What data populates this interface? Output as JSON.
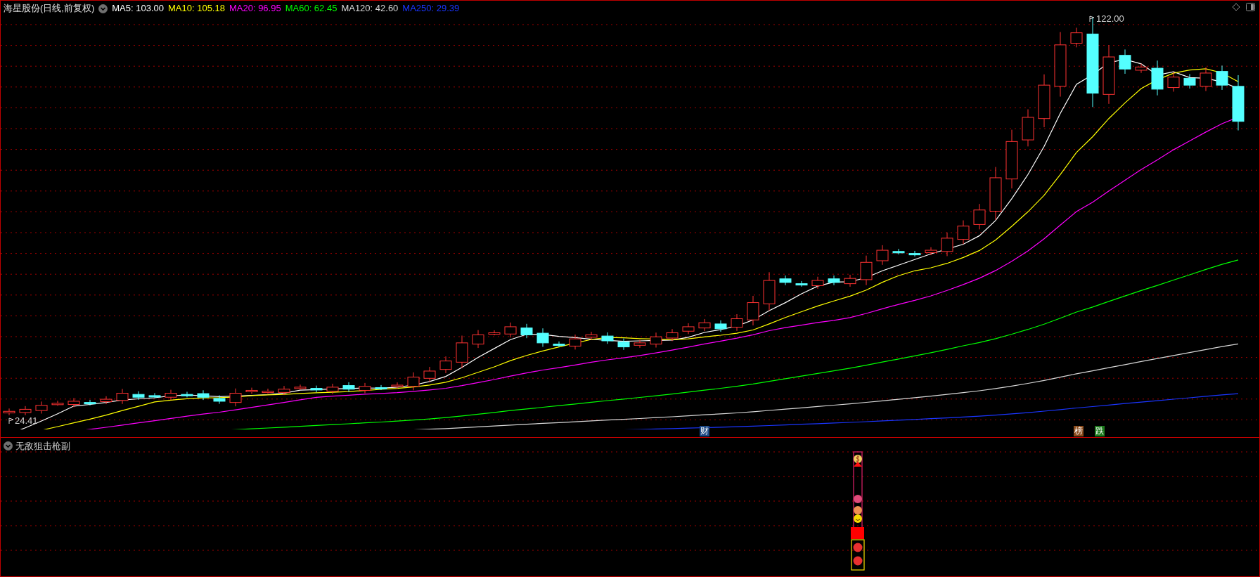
{
  "chart": {
    "title": "海星股份(日线,前复权)",
    "moving_averages": [
      {
        "label": "MA5: 103.00",
        "color": "#ffffff"
      },
      {
        "label": "MA10: 105.18",
        "color": "#ffff00"
      },
      {
        "label": "MA20: 96.95",
        "color": "#ff00ff"
      },
      {
        "label": "MA60: 62.45",
        "color": "#00ff00"
      },
      {
        "label": "MA120: 42.60",
        "color": "#d8d8d8"
      },
      {
        "label": "MA250: 29.39",
        "color": "#1a35ff"
      }
    ],
    "high_label": "122.00",
    "low_label": "24.41",
    "events": [
      {
        "label": "财",
        "color": "#1d4a86"
      },
      {
        "label": "榜",
        "color": "#8a4a1a"
      },
      {
        "label": "跌",
        "color": "#1c7a1c"
      }
    ]
  },
  "indicator": {
    "title": "无敌狙击枪副"
  }
}
